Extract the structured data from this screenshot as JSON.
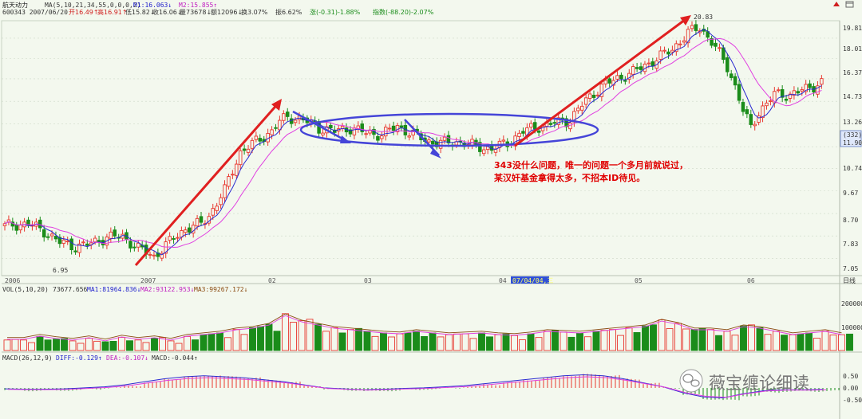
{
  "header": {
    "stock_name": "航天动力",
    "ma_params": "MA(5,10,21,34,55,0,0,0,2)",
    "m1": "M1:16.063↓",
    "m2": "M2:15.855↑",
    "code_date": "600343 2007/06/20",
    "open": "开16.49↑",
    "high": "高16.91↑",
    "low": "低15.82↓",
    "close": "收16.06↓",
    "volume": "量73678↓",
    "amount": "额12096↓",
    "turnover": "换3.07%",
    "amplitude": "振6.62%",
    "change": "涨(-0.31)-1.88%",
    "index_change": "指数(-88.20)-2.07%"
  },
  "price_axis": {
    "ticks": [
      "19.81",
      "18.01",
      "16.37",
      "14.73",
      "13.26",
      "11.90",
      "10.74",
      "9.67",
      "8.70",
      "7.83",
      "7.05"
    ],
    "current_code": "(332)",
    "current_price": "11.90"
  },
  "time_axis": {
    "labels": [
      "2006",
      "2007",
      "02",
      "03",
      "04",
      "05",
      "06"
    ],
    "cursor_date": "07/04/04,三",
    "right_label": "日线"
  },
  "annotations": {
    "high_label": "20.83",
    "low_label": "6.95",
    "comment_line1": "343没什么问题，唯一的问题一个多月前就说过，",
    "comment_line2": "某汉奸基金拿得太多，不招本ID待见。",
    "watermark": "薇宝缠论细读"
  },
  "volume_panel": {
    "title": "VOL(5,10,20)",
    "vol": "73677.656",
    "ma1": "MA1:81964.836↓",
    "ma2": "MA2:93122.953↓",
    "ma3": "MA3:99267.172↓",
    "ticks": [
      "200000",
      "100000"
    ]
  },
  "macd_panel": {
    "title": "MACD(26,12,9)",
    "diff": "DIFF:-0.129↑",
    "dea": "DEA:-0.107↓",
    "macd": "MACD:-0.044↑",
    "ticks": [
      "0.50",
      "0.00",
      "-0.50"
    ]
  },
  "colors": {
    "background": "#f3f8ee",
    "up": "#e8382f",
    "down": "#1a8c1a",
    "ma_fast": "#2a2ad0",
    "ma_slow": "#e040e0",
    "arrow_red": "#e02020",
    "arrow_blue": "#4040dd",
    "comment": "#e00000"
  },
  "chart_data": {
    "type": "candlestick",
    "ylim": [
      6.5,
      21.5
    ],
    "log_scale": true,
    "control_points": [
      [
        0,
        8.2
      ],
      [
        6,
        8.3
      ],
      [
        10,
        8.0
      ],
      [
        14,
        7.6
      ],
      [
        18,
        7.45
      ],
      [
        22,
        7.55
      ],
      [
        26,
        7.8
      ],
      [
        30,
        7.8
      ],
      [
        34,
        7.4
      ],
      [
        38,
        7.1
      ],
      [
        41,
        7.5
      ],
      [
        46,
        8.1
      ],
      [
        50,
        8.3
      ],
      [
        52,
        8.6
      ],
      [
        56,
        9.7
      ],
      [
        60,
        11.6
      ],
      [
        64,
        12.2
      ],
      [
        68,
        12.8
      ],
      [
        70,
        13.4
      ],
      [
        72,
        13.7
      ],
      [
        76,
        13.5
      ],
      [
        80,
        13.0
      ],
      [
        84,
        12.8
      ],
      [
        88,
        13.0
      ],
      [
        92,
        12.7
      ],
      [
        96,
        12.6
      ],
      [
        100,
        13.1
      ],
      [
        104,
        12.6
      ],
      [
        108,
        12.2
      ],
      [
        112,
        12.1
      ],
      [
        116,
        12.2
      ],
      [
        120,
        11.9
      ],
      [
        124,
        11.8
      ],
      [
        128,
        12.1
      ],
      [
        132,
        12.8
      ],
      [
        136,
        13.1
      ],
      [
        140,
        13.3
      ],
      [
        144,
        13.5
      ],
      [
        148,
        14.8
      ],
      [
        152,
        15.8
      ],
      [
        156,
        16.4
      ],
      [
        160,
        16.9
      ],
      [
        164,
        17.6
      ],
      [
        170,
        18.8
      ],
      [
        174,
        20.3
      ],
      [
        177,
        20.83
      ],
      [
        180,
        19.5
      ],
      [
        184,
        17.3
      ],
      [
        186,
        15.8
      ],
      [
        188,
        14.1
      ],
      [
        190,
        13.0
      ],
      [
        192,
        14.0
      ],
      [
        196,
        15.2
      ],
      [
        200,
        15.2
      ],
      [
        204,
        15.6
      ],
      [
        208,
        16.1
      ]
    ],
    "volume_levels": [
      60,
      60,
      80,
      65,
      55,
      70,
      50,
      75,
      60,
      70,
      55,
      80,
      90,
      100,
      120,
      130,
      150,
      210,
      170,
      150,
      130,
      120,
      110,
      100,
      95,
      110,
      100,
      90,
      95,
      100,
      90,
      85,
      95,
      110,
      105,
      100,
      110,
      120,
      130,
      140,
      175,
      155,
      120,
      120,
      110,
      140,
      130,
      110,
      90,
      100,
      110,
      90
    ],
    "macd_levels": [
      -0.1,
      -0.12,
      -0.12,
      -0.1,
      -0.05,
      0.0,
      0.1,
      0.25,
      0.4,
      0.5,
      0.55,
      0.5,
      0.45,
      0.35,
      0.25,
      0.1,
      -0.05,
      -0.1,
      -0.15,
      -0.12,
      -0.08,
      -0.05,
      0.0,
      0.05,
      0.15,
      0.25,
      0.35,
      0.45,
      0.55,
      0.6,
      0.55,
      0.4,
      0.2,
      0.0,
      -0.3,
      -0.5,
      -0.55,
      -0.35,
      -0.2,
      -0.15,
      -0.15,
      -0.13
    ]
  }
}
